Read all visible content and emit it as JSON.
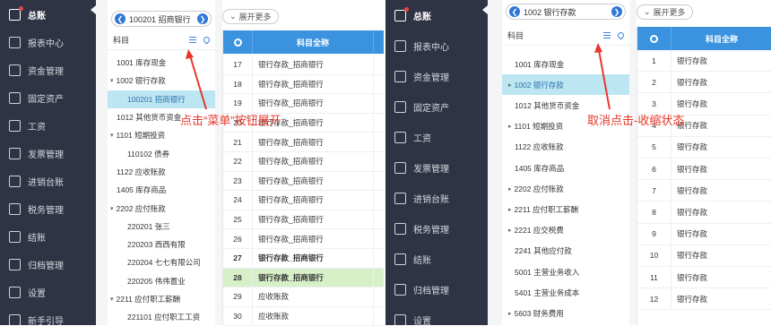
{
  "colors": {
    "sidebar": "#2f3444",
    "accent": "#3b93e0",
    "annotation": "#e8372a",
    "selected_row": "#bde6f3",
    "highlight_row": "#d8f0c8"
  },
  "left_sidebar": {
    "items": [
      {
        "label": "总账",
        "icon": "ledger-icon"
      },
      {
        "label": "报表中心",
        "icon": "chart-icon"
      },
      {
        "label": "资金管理",
        "icon": "money-icon"
      },
      {
        "label": "固定资产",
        "icon": "asset-icon"
      },
      {
        "label": "工资",
        "icon": "salary-icon"
      },
      {
        "label": "发票管理",
        "icon": "invoice-icon"
      },
      {
        "label": "进销台账",
        "icon": "inventory-icon"
      },
      {
        "label": "税务管理",
        "icon": "tax-icon"
      },
      {
        "label": "结账",
        "icon": "close-book-icon"
      },
      {
        "label": "归档管理",
        "icon": "archive-icon"
      },
      {
        "label": "设置",
        "icon": "settings-icon"
      },
      {
        "label": "新手引导",
        "icon": "guide-icon"
      }
    ]
  },
  "left_tree": {
    "selector_value": "100201 招商银行",
    "header_label": "科目",
    "nodes": [
      {
        "label": "1001 库存现金",
        "arrow": ""
      },
      {
        "label": "1002 银行存款",
        "arrow": "▾"
      },
      {
        "label": "100201 招商银行",
        "arrow": "",
        "selected": true
      },
      {
        "label": "1012 其他货币资金",
        "arrow": ""
      },
      {
        "label": "1101 短期投资",
        "arrow": "▾"
      },
      {
        "label": "110102 债券",
        "arrow": ""
      },
      {
        "label": "1122 应收账款",
        "arrow": ""
      },
      {
        "label": "1405 库存商品",
        "arrow": ""
      },
      {
        "label": "2202 应付账款",
        "arrow": "▾"
      },
      {
        "label": "220201 张三",
        "arrow": ""
      },
      {
        "label": "220203 西西有限",
        "arrow": ""
      },
      {
        "label": "220204 七七有限公司",
        "arrow": ""
      },
      {
        "label": "220205 伟伟置业",
        "arrow": ""
      },
      {
        "label": "2211 应付职工薪酬",
        "arrow": "▾"
      },
      {
        "label": "221101 应付职工工资",
        "arrow": ""
      }
    ]
  },
  "left_grid": {
    "expand_label": "展开更多",
    "header": "科目全称",
    "rows": [
      {
        "num": "17",
        "text": "银行存款_招商银行"
      },
      {
        "num": "18",
        "text": "银行存款_招商银行"
      },
      {
        "num": "19",
        "text": "银行存款_招商银行"
      },
      {
        "num": "20",
        "text": "银行存款_招商银行"
      },
      {
        "num": "21",
        "text": "银行存款_招商银行"
      },
      {
        "num": "22",
        "text": "银行存款_招商银行"
      },
      {
        "num": "23",
        "text": "银行存款_招商银行"
      },
      {
        "num": "24",
        "text": "银行存款_招商银行"
      },
      {
        "num": "25",
        "text": "银行存款_招商银行"
      },
      {
        "num": "26",
        "text": "银行存款_招商银行"
      },
      {
        "num": "27",
        "text": "银行存款_招商银行",
        "bold": true
      },
      {
        "num": "28",
        "text": "银行存款_招商银行",
        "bold": true,
        "highlight": true
      },
      {
        "num": "29",
        "text": "应收账款"
      },
      {
        "num": "30",
        "text": "应收账款"
      }
    ]
  },
  "left_annotation": "点击“菜单”按钮展开",
  "right_sidebar": {
    "items": [
      {
        "label": "总账",
        "icon": "ledger-icon"
      },
      {
        "label": "报表中心",
        "icon": "chart-icon"
      },
      {
        "label": "资金管理",
        "icon": "money-icon"
      },
      {
        "label": "固定资产",
        "icon": "asset-icon"
      },
      {
        "label": "工资",
        "icon": "salary-icon"
      },
      {
        "label": "发票管理",
        "icon": "invoice-icon"
      },
      {
        "label": "进销台账",
        "icon": "inventory-icon"
      },
      {
        "label": "税务管理",
        "icon": "tax-icon"
      },
      {
        "label": "结账",
        "icon": "close-book-icon"
      },
      {
        "label": "归档管理",
        "icon": "archive-icon"
      },
      {
        "label": "设置",
        "icon": "settings-icon"
      }
    ]
  },
  "right_tree": {
    "selector_value": "1002 银行存款",
    "header_label": "科目",
    "nodes": [
      {
        "label": "1001 库存现金",
        "arrow": ""
      },
      {
        "label": "1002 银行存款",
        "arrow": "▸",
        "selected": true
      },
      {
        "label": "1012 其他货币资金",
        "arrow": ""
      },
      {
        "label": "1101 短期投资",
        "arrow": "▸"
      },
      {
        "label": "1122 应收账款",
        "arrow": ""
      },
      {
        "label": "1405 库存商品",
        "arrow": ""
      },
      {
        "label": "2202 应付账款",
        "arrow": "▸"
      },
      {
        "label": "2211 应付职工薪酬",
        "arrow": "▸"
      },
      {
        "label": "2221 应交税费",
        "arrow": "▸"
      },
      {
        "label": "2241 其他应付款",
        "arrow": ""
      },
      {
        "label": "5001 主营业务收入",
        "arrow": ""
      },
      {
        "label": "5401 主营业务成本",
        "arrow": ""
      },
      {
        "label": "5603 财务费用",
        "arrow": "▸"
      }
    ]
  },
  "right_grid": {
    "expand_label": "展开更多",
    "header": "科目全称",
    "rows": [
      {
        "num": "1",
        "text": "银行存款"
      },
      {
        "num": "2",
        "text": "银行存款"
      },
      {
        "num": "3",
        "text": "银行存款"
      },
      {
        "num": "4",
        "text": "银行存款"
      },
      {
        "num": "5",
        "text": "银行存款"
      },
      {
        "num": "6",
        "text": "银行存款"
      },
      {
        "num": "7",
        "text": "银行存款"
      },
      {
        "num": "8",
        "text": "银行存款"
      },
      {
        "num": "9",
        "text": "银行存款"
      },
      {
        "num": "10",
        "text": "银行存款"
      },
      {
        "num": "11",
        "text": "银行存款"
      },
      {
        "num": "12",
        "text": "银行存款"
      }
    ]
  },
  "right_annotation": "取消点击-收缩状态"
}
